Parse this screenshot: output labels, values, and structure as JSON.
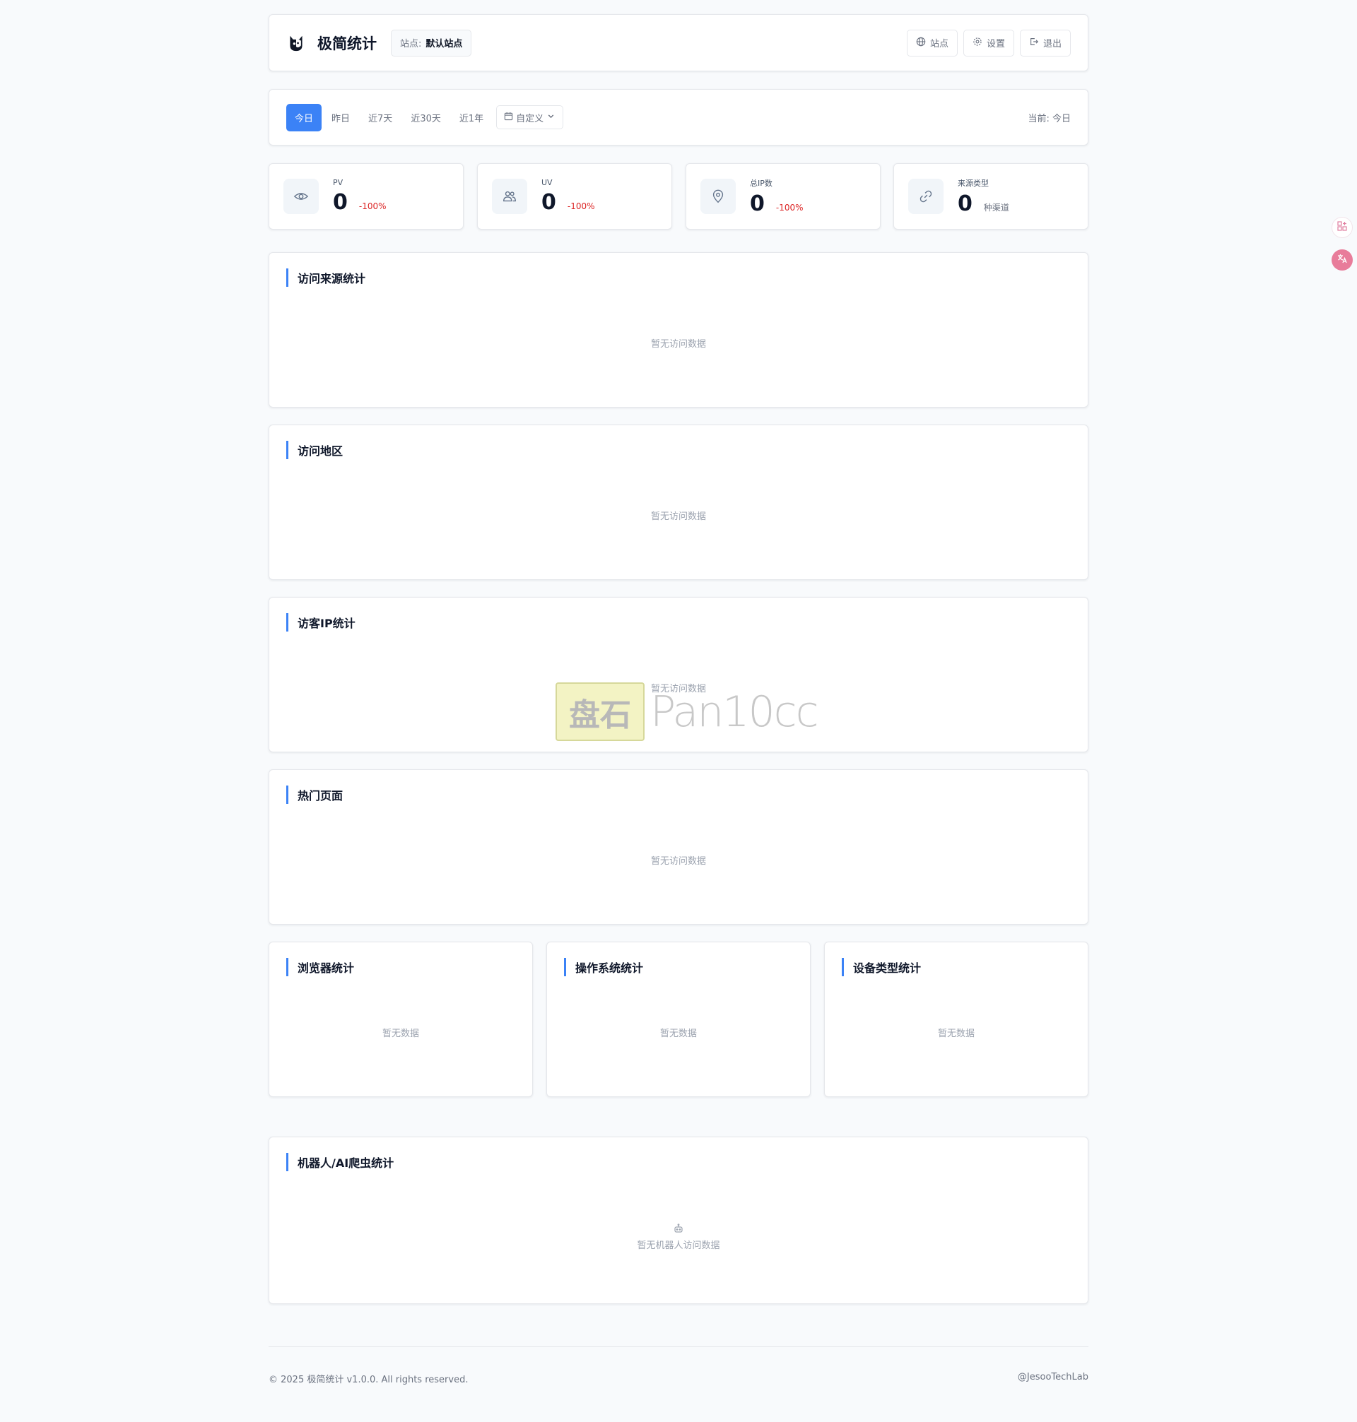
{
  "header": {
    "title": "极简统计",
    "site_label": "站点:",
    "site_value": "默认站点",
    "actions": [
      {
        "label": "站点",
        "icon": "globe-icon"
      },
      {
        "label": "设置",
        "icon": "gear-icon"
      },
      {
        "label": "退出",
        "icon": "logout-icon"
      }
    ]
  },
  "date_range": {
    "options": [
      "今日",
      "昨日",
      "近7天",
      "近30天",
      "近1年"
    ],
    "active": "今日",
    "custom_label": "自定义",
    "current_text": "当前: 今日"
  },
  "stats": [
    {
      "label": "PV",
      "value": "0",
      "delta": "-100%",
      "icon": "eye-icon"
    },
    {
      "label": "UV",
      "value": "0",
      "delta": "-100%",
      "icon": "users-icon"
    },
    {
      "label": "总IP数",
      "value": "0",
      "delta": "-100%",
      "icon": "map-pin-icon"
    },
    {
      "label": "来源类型",
      "value": "0",
      "unit": "种渠道",
      "icon": "link-icon"
    }
  ],
  "sections": [
    {
      "title": "访问来源统计",
      "empty": "暂无访问数据"
    },
    {
      "title": "访问地区",
      "empty": "暂无访问数据"
    },
    {
      "title": "访客IP统计",
      "empty": "暂无访问数据"
    },
    {
      "title": "热门页面",
      "empty": "暂无访问数据"
    }
  ],
  "small_sections": [
    {
      "title": "浏览器统计",
      "empty": "暂无数据"
    },
    {
      "title": "操作系统统计",
      "empty": "暂无数据"
    },
    {
      "title": "设备类型统计",
      "empty": "暂无数据"
    }
  ],
  "robot": {
    "title": "机器人/AI爬虫统计",
    "empty": "暂无机器人访问数据"
  },
  "footer": {
    "left": "© 2025 极简统计 v1.0.0. All rights reserved.",
    "right": "@JesooTechLab"
  },
  "watermark": {
    "logo_text": "盘石",
    "text": "Pan10cc"
  },
  "colors": {
    "accent": "#3b82f6",
    "negative": "#dc2626",
    "background": "#f8fafc"
  }
}
